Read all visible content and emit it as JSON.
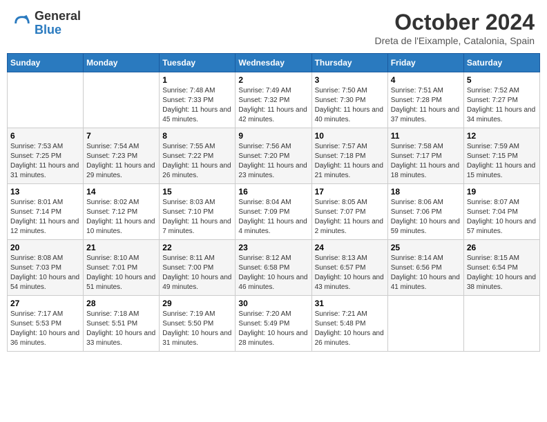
{
  "header": {
    "logo_general": "General",
    "logo_blue": "Blue",
    "month_title": "October 2024",
    "subtitle": "Dreta de l'Eixample, Catalonia, Spain"
  },
  "days_of_week": [
    "Sunday",
    "Monday",
    "Tuesday",
    "Wednesday",
    "Thursday",
    "Friday",
    "Saturday"
  ],
  "weeks": [
    [
      {
        "day": null,
        "info": null
      },
      {
        "day": null,
        "info": null
      },
      {
        "day": "1",
        "info": "Sunrise: 7:48 AM\nSunset: 7:33 PM\nDaylight: 11 hours and 45 minutes."
      },
      {
        "day": "2",
        "info": "Sunrise: 7:49 AM\nSunset: 7:32 PM\nDaylight: 11 hours and 42 minutes."
      },
      {
        "day": "3",
        "info": "Sunrise: 7:50 AM\nSunset: 7:30 PM\nDaylight: 11 hours and 40 minutes."
      },
      {
        "day": "4",
        "info": "Sunrise: 7:51 AM\nSunset: 7:28 PM\nDaylight: 11 hours and 37 minutes."
      },
      {
        "day": "5",
        "info": "Sunrise: 7:52 AM\nSunset: 7:27 PM\nDaylight: 11 hours and 34 minutes."
      }
    ],
    [
      {
        "day": "6",
        "info": "Sunrise: 7:53 AM\nSunset: 7:25 PM\nDaylight: 11 hours and 31 minutes."
      },
      {
        "day": "7",
        "info": "Sunrise: 7:54 AM\nSunset: 7:23 PM\nDaylight: 11 hours and 29 minutes."
      },
      {
        "day": "8",
        "info": "Sunrise: 7:55 AM\nSunset: 7:22 PM\nDaylight: 11 hours and 26 minutes."
      },
      {
        "day": "9",
        "info": "Sunrise: 7:56 AM\nSunset: 7:20 PM\nDaylight: 11 hours and 23 minutes."
      },
      {
        "day": "10",
        "info": "Sunrise: 7:57 AM\nSunset: 7:18 PM\nDaylight: 11 hours and 21 minutes."
      },
      {
        "day": "11",
        "info": "Sunrise: 7:58 AM\nSunset: 7:17 PM\nDaylight: 11 hours and 18 minutes."
      },
      {
        "day": "12",
        "info": "Sunrise: 7:59 AM\nSunset: 7:15 PM\nDaylight: 11 hours and 15 minutes."
      }
    ],
    [
      {
        "day": "13",
        "info": "Sunrise: 8:01 AM\nSunset: 7:14 PM\nDaylight: 11 hours and 12 minutes."
      },
      {
        "day": "14",
        "info": "Sunrise: 8:02 AM\nSunset: 7:12 PM\nDaylight: 11 hours and 10 minutes."
      },
      {
        "day": "15",
        "info": "Sunrise: 8:03 AM\nSunset: 7:10 PM\nDaylight: 11 hours and 7 minutes."
      },
      {
        "day": "16",
        "info": "Sunrise: 8:04 AM\nSunset: 7:09 PM\nDaylight: 11 hours and 4 minutes."
      },
      {
        "day": "17",
        "info": "Sunrise: 8:05 AM\nSunset: 7:07 PM\nDaylight: 11 hours and 2 minutes."
      },
      {
        "day": "18",
        "info": "Sunrise: 8:06 AM\nSunset: 7:06 PM\nDaylight: 10 hours and 59 minutes."
      },
      {
        "day": "19",
        "info": "Sunrise: 8:07 AM\nSunset: 7:04 PM\nDaylight: 10 hours and 57 minutes."
      }
    ],
    [
      {
        "day": "20",
        "info": "Sunrise: 8:08 AM\nSunset: 7:03 PM\nDaylight: 10 hours and 54 minutes."
      },
      {
        "day": "21",
        "info": "Sunrise: 8:10 AM\nSunset: 7:01 PM\nDaylight: 10 hours and 51 minutes."
      },
      {
        "day": "22",
        "info": "Sunrise: 8:11 AM\nSunset: 7:00 PM\nDaylight: 10 hours and 49 minutes."
      },
      {
        "day": "23",
        "info": "Sunrise: 8:12 AM\nSunset: 6:58 PM\nDaylight: 10 hours and 46 minutes."
      },
      {
        "day": "24",
        "info": "Sunrise: 8:13 AM\nSunset: 6:57 PM\nDaylight: 10 hours and 43 minutes."
      },
      {
        "day": "25",
        "info": "Sunrise: 8:14 AM\nSunset: 6:56 PM\nDaylight: 10 hours and 41 minutes."
      },
      {
        "day": "26",
        "info": "Sunrise: 8:15 AM\nSunset: 6:54 PM\nDaylight: 10 hours and 38 minutes."
      }
    ],
    [
      {
        "day": "27",
        "info": "Sunrise: 7:17 AM\nSunset: 5:53 PM\nDaylight: 10 hours and 36 minutes."
      },
      {
        "day": "28",
        "info": "Sunrise: 7:18 AM\nSunset: 5:51 PM\nDaylight: 10 hours and 33 minutes."
      },
      {
        "day": "29",
        "info": "Sunrise: 7:19 AM\nSunset: 5:50 PM\nDaylight: 10 hours and 31 minutes."
      },
      {
        "day": "30",
        "info": "Sunrise: 7:20 AM\nSunset: 5:49 PM\nDaylight: 10 hours and 28 minutes."
      },
      {
        "day": "31",
        "info": "Sunrise: 7:21 AM\nSunset: 5:48 PM\nDaylight: 10 hours and 26 minutes."
      },
      {
        "day": null,
        "info": null
      },
      {
        "day": null,
        "info": null
      }
    ]
  ]
}
